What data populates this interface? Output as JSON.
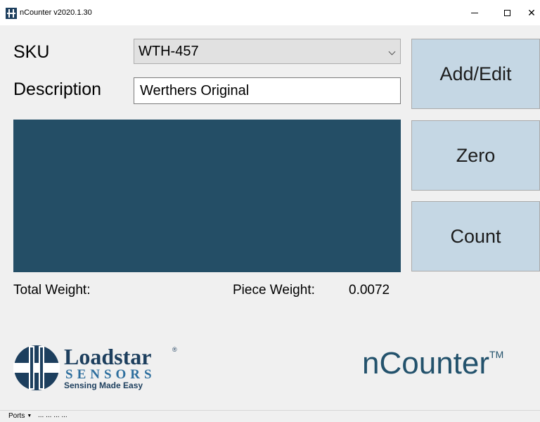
{
  "window": {
    "title": "nCounter v2020.1.30",
    "close_glyph": "✕"
  },
  "form": {
    "sku_label": "SKU",
    "sku_value": "WTH-457",
    "description_label": "Description",
    "description_value": "Werthers Original"
  },
  "display": {
    "color": "#244e66"
  },
  "buttons": {
    "add_edit": "Add/Edit",
    "zero": "Zero",
    "count": "Count"
  },
  "weights": {
    "total_label": "Total Weight:",
    "piece_label": "Piece Weight:",
    "piece_value": "0.0072"
  },
  "branding": {
    "logo_word": "Loadstar",
    "logo_sub": "SENSORS",
    "logo_tagline": "Sensing Made Easy",
    "product_name": "nCounter",
    "trademark": "TM"
  },
  "statusbar": {
    "ports_label": "Ports",
    "ports_status": "... ... ... ..."
  },
  "colors": {
    "accent": "#23526c",
    "button_bg": "#c5d7e4",
    "window_bg": "#f0f0f0"
  }
}
